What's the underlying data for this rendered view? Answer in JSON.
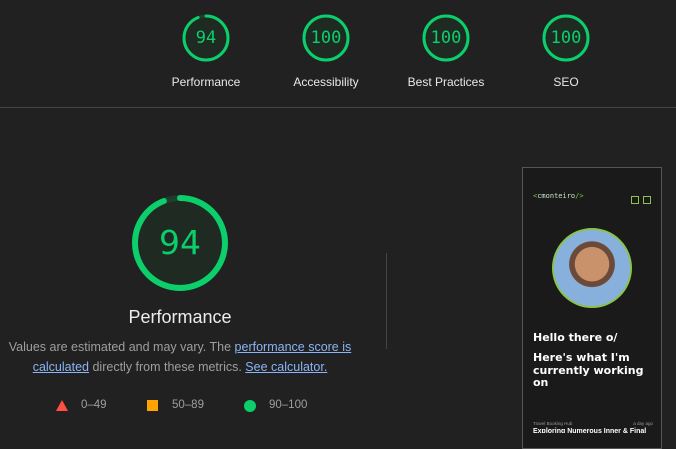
{
  "summary": [
    {
      "score": "94",
      "label": "Performance",
      "fraction": 0.94
    },
    {
      "score": "100",
      "label": "Accessibility",
      "fraction": 1.0
    },
    {
      "score": "100",
      "label": "Best Practices",
      "fraction": 1.0
    },
    {
      "score": "100",
      "label": "SEO",
      "fraction": 1.0
    }
  ],
  "performance": {
    "score": "94",
    "fraction": 0.94,
    "title": "Performance",
    "desc_prefix": "Values are estimated and may vary. The ",
    "link_score": "performance score is calculated",
    "desc_middle": " directly from these metrics. ",
    "link_calc": "See calculator."
  },
  "legend": [
    {
      "range": "0–49",
      "shape": "triangle",
      "color": "#ff4e42"
    },
    {
      "range": "50–89",
      "shape": "square",
      "color": "#ffa400"
    },
    {
      "range": "90–100",
      "shape": "circle",
      "color": "#0cce6b"
    }
  ],
  "colors": {
    "pass": "#0cce6b",
    "accent_green": "#8bc34a",
    "link": "#8ab4f8"
  },
  "screenshot": {
    "logo_open": "<",
    "logo_name": "cmonteiro",
    "logo_close": "/>",
    "hello": "Hello there o/",
    "working": "Here's what I'm currently working on",
    "post_tag": "Travel Booking Hub",
    "post_time": "a day ago",
    "post_title": "Exploring Numerous Inner & Final"
  }
}
